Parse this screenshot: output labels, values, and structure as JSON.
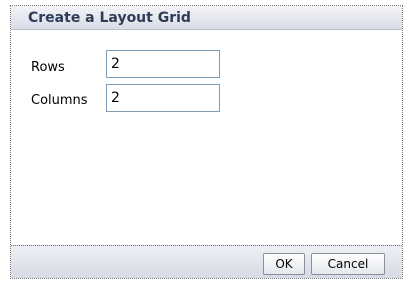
{
  "dialog": {
    "title": "Create a Layout Grid",
    "fields": {
      "rows": {
        "label": "Rows",
        "value": "2"
      },
      "columns": {
        "label": "Columns",
        "value": "2"
      }
    },
    "buttons": {
      "ok": "OK",
      "cancel": "Cancel"
    }
  }
}
